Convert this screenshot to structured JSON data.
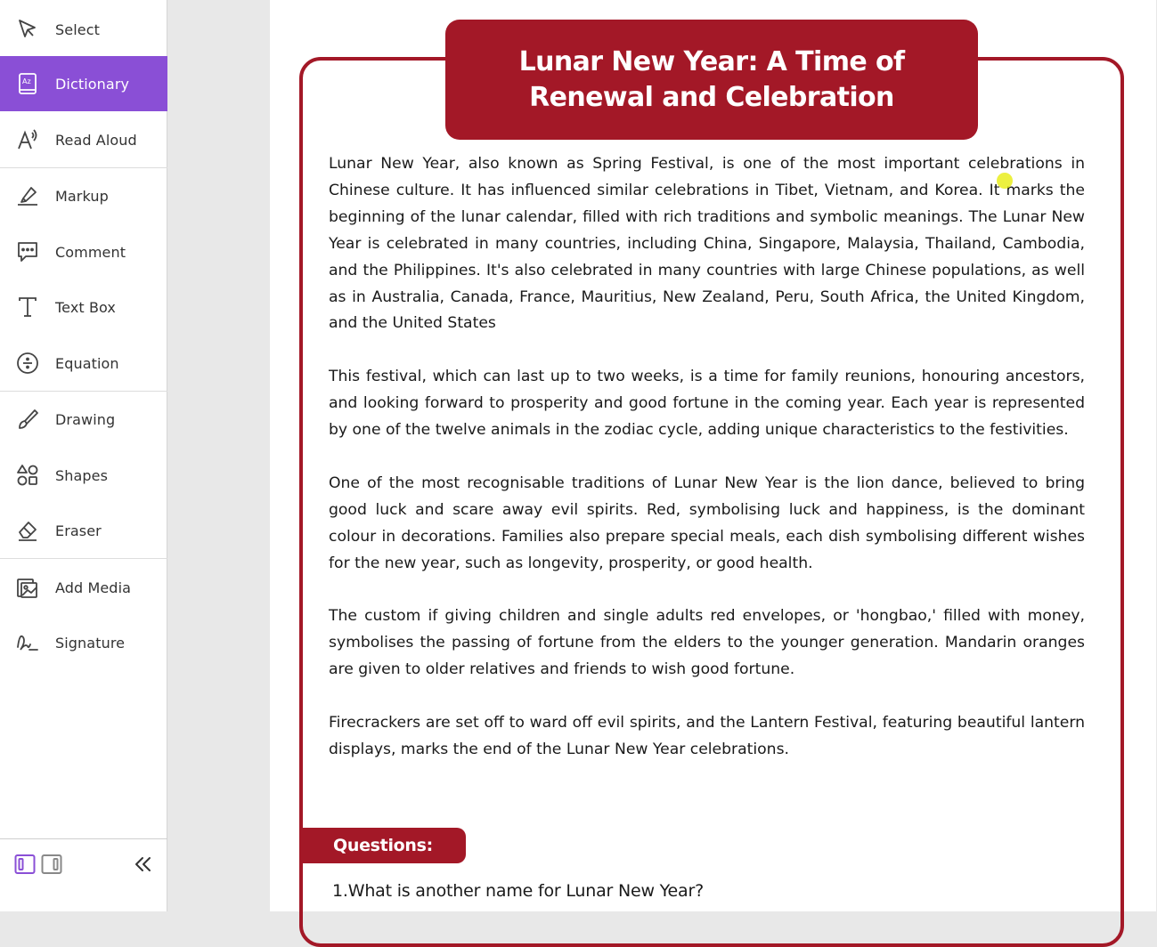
{
  "sidebar": {
    "items": [
      {
        "label": "Select",
        "icon": "cursor-arrow-icon"
      },
      {
        "label": "Dictionary",
        "icon": "dictionary-icon",
        "active": true
      },
      {
        "label": "Read Aloud",
        "icon": "read-aloud-icon"
      },
      {
        "label": "Markup",
        "icon": "highlighter-icon"
      },
      {
        "label": "Comment",
        "icon": "comment-icon"
      },
      {
        "label": "Text Box",
        "icon": "text-box-icon"
      },
      {
        "label": "Equation",
        "icon": "division-icon"
      },
      {
        "label": "Drawing",
        "icon": "brush-icon"
      },
      {
        "label": "Shapes",
        "icon": "shapes-icon"
      },
      {
        "label": "Eraser",
        "icon": "eraser-icon"
      },
      {
        "label": "Add Media",
        "icon": "add-media-icon"
      },
      {
        "label": "Signature",
        "icon": "signature-icon"
      }
    ],
    "footer": {
      "layout_icons": [
        "single-panel-icon",
        "split-panel-icon"
      ],
      "collapse_icon": "double-chevron-left-icon"
    }
  },
  "document": {
    "title": "Lunar New Year: A Time of Renewal and Celebration",
    "paragraphs": [
      "Lunar New Year, also known as Spring Festival, is one of the most important celebrations in Chinese culture. It has influenced similar celebrations in Tibet, Vietnam, and Korea. It marks the beginning of the lunar calendar, filled with rich traditions and symbolic meanings. The Lunar New Year is celebrated in many countries, including China, Singapore, Malaysia, Thailand, Cambodia, and the Philippines. It's also celebrated in many countries with large Chinese populations, as well as in Australia, Canada, France, Mauritius, New Zealand, Peru, South Africa, the United Kingdom, and the United States",
      "This festival, which can last up to two weeks, is a time for family reunions, honouring ancestors, and looking forward to prosperity and good fortune in the coming year. Each year is represented by one of the twelve animals in the zodiac cycle, adding unique characteristics to the festivities.",
      "One of the most recognisable traditions of Lunar New Year is the lion dance, believed to bring good luck and scare away evil spirits. Red, symbolising luck and happiness, is the dominant colour in decorations. Families also prepare special meals, each dish symbolising different wishes for the new year, such as longevity, prosperity, or good health.",
      "The custom if giving children and single adults red envelopes, or 'hongbao,' filled with money, symbolises the passing of fortune from the elders to the younger generation. Mandarin oranges are given to older relatives and friends to wish good fortune.",
      "Firecrackers are set off to ward off evil spirits, and the Lantern Festival, featuring beautiful lantern displays, marks the end of the Lunar New Year celebrations."
    ],
    "questions_label": "Questions:",
    "questions": [
      "1.What is another name for Lunar New Year?"
    ]
  },
  "colors": {
    "accent": "#8a4fd6",
    "brand_red": "#a31827"
  }
}
